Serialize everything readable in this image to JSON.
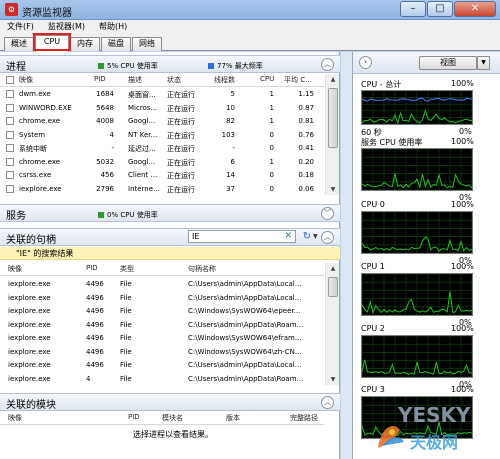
{
  "window": {
    "title": "资源监视器"
  },
  "menu": [
    "文件(F)",
    "监视器(M)",
    "帮助(H)"
  ],
  "tabs": [
    "概述",
    "CPU",
    "内存",
    "磁盘",
    "网络"
  ],
  "processes": {
    "title": "进程",
    "cpu_usage": "5% CPU 使用率",
    "max_freq": "77% 最大频率",
    "columns": [
      "映像",
      "PID",
      "描述",
      "状态",
      "线程数",
      "CPU",
      "平均 C..."
    ],
    "rows": [
      [
        "dwm.exe",
        "1684",
        "桌面窗...",
        "正在运行",
        "5",
        "1",
        "1.15"
      ],
      [
        "WINWORD.EXE",
        "5648",
        "Micros...",
        "正在运行",
        "10",
        "1",
        "0.87"
      ],
      [
        "chrome.exe",
        "4008",
        "Googl...",
        "正在运行",
        "82",
        "1",
        "0.81"
      ],
      [
        "System",
        "4",
        "NT Ker...",
        "正在运行",
        "103",
        "0",
        "0.76"
      ],
      [
        "系统中断",
        "-",
        "延迟过...",
        "正在运行",
        "-",
        "0",
        "0.41"
      ],
      [
        "chrome.exe",
        "5032",
        "Googl...",
        "正在运行",
        "6",
        "1",
        "0.20"
      ],
      [
        "csrss.exe",
        "456",
        "Client ...",
        "正在运行",
        "14",
        "0",
        "0.18"
      ],
      [
        "iexplore.exe",
        "2796",
        "Interne...",
        "正在运行",
        "37",
        "0",
        "0.06"
      ]
    ]
  },
  "services": {
    "title": "服务",
    "cpu_usage": "0% CPU 使用率"
  },
  "handles": {
    "title": "关联的句柄",
    "search_value": "IE",
    "search_result_label": "\"IE\" 的搜索结果",
    "columns": [
      "映像",
      "PID",
      "类型",
      "句柄名称"
    ],
    "rows": [
      [
        "iexplore.exe",
        "4496",
        "File",
        "C:\\Users\\admin\\AppData\\Local..."
      ],
      [
        "iexplore.exe",
        "4496",
        "File",
        "C:\\Users\\admin\\AppData\\Local..."
      ],
      [
        "iexplore.exe",
        "4496",
        "File",
        "C:\\Windows\\SysWOW64\\epeer..."
      ],
      [
        "iexplore.exe",
        "4496",
        "File",
        "C:\\Users\\admin\\AppData\\Roam..."
      ],
      [
        "iexplore.exe",
        "4496",
        "File",
        "C:\\Windows\\SysWOW64\\efram..."
      ],
      [
        "iexplore.exe",
        "4496",
        "File",
        "C:\\Windows\\SysWOW64\\zh-CN..."
      ],
      [
        "iexplore.exe",
        "4496",
        "File",
        "C:\\Users\\admin\\AppData\\Local..."
      ],
      [
        "iexplore.exe",
        "4",
        "File",
        "C:\\Users\\admin\\AppData\\Roam..."
      ]
    ]
  },
  "modules": {
    "title": "关联的模块",
    "columns": [
      "映像",
      "PID",
      "模块名",
      "版本",
      "完整路径"
    ],
    "empty_text": "选择进程以查看结果。"
  },
  "right_panel": {
    "view_label": "视图",
    "graphs": [
      {
        "title": "CPU - 总计",
        "max": "100%",
        "footer_left": "60 秒",
        "footer_right": "0%"
      },
      {
        "title": "服务 CPU 使用率",
        "max": "100%",
        "footer_left": "",
        "footer_right": "0%"
      },
      {
        "title": "CPU 0",
        "max": "100%",
        "footer_left": "",
        "footer_right": "0%"
      },
      {
        "title": "CPU 1",
        "max": "100%",
        "footer_left": "",
        "footer_right": "0%"
      },
      {
        "title": "CPU 2",
        "max": "100%",
        "footer_left": "",
        "footer_right": "0%"
      },
      {
        "title": "CPU 3",
        "max": "100%",
        "footer_left": "",
        "footer_right": ""
      }
    ]
  },
  "watermark": {
    "text": "Yesky 天极网"
  },
  "colors": {
    "cpu_square": "#2d9a2d",
    "freq_square": "#2f6fd6",
    "graph_line": "#22c222",
    "graph_blue": "#3f6ee0",
    "highlight": "#e02020"
  }
}
